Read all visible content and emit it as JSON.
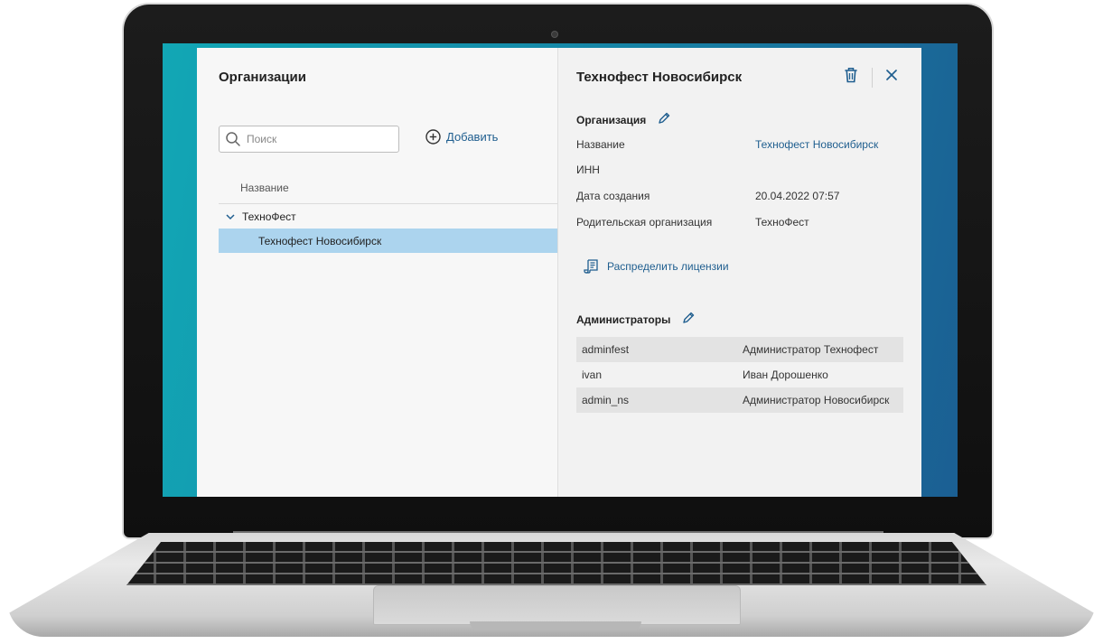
{
  "left_panel": {
    "title": "Организации",
    "search": {
      "placeholder": "Поиск",
      "value": ""
    },
    "add_label": "Добавить",
    "column_header": "Название",
    "tree": [
      {
        "label": "ТехноФест",
        "expanded": true
      },
      {
        "label": "Технофест Новосибирск",
        "selected": true
      }
    ]
  },
  "detail": {
    "title": "Технофест Новосибирск",
    "organization_section": {
      "title": "Организация",
      "rows": [
        {
          "key": "Название",
          "value": "Технофест Новосибирск"
        },
        {
          "key": "ИНН",
          "value": ""
        },
        {
          "key": "Дата создания",
          "value": "20.04.2022 07:57"
        },
        {
          "key": "Родительская организация",
          "value": "ТехноФест"
        }
      ]
    },
    "licenses_link": "Распределить лицензии",
    "admins_section": {
      "title": "Администраторы",
      "rows": [
        {
          "login": "adminfest",
          "name": "Администратор Технофест"
        },
        {
          "login": "ivan",
          "name": "Иван Дорошенко"
        },
        {
          "login": "admin_ns",
          "name": "Администратор Новосибирск"
        }
      ]
    }
  },
  "icons": {
    "search": "search-icon",
    "add": "plus-circle-icon",
    "chevron": "chevron-down-icon",
    "delete": "trash-icon",
    "close": "close-icon",
    "edit": "pencil-icon",
    "licenses": "scroll-icon"
  },
  "colors": {
    "accent": "#1f5e8f",
    "selected_row": "#acd4ee",
    "screen_gradient_start": "#12a7b5",
    "screen_gradient_end": "#1b5f93"
  }
}
